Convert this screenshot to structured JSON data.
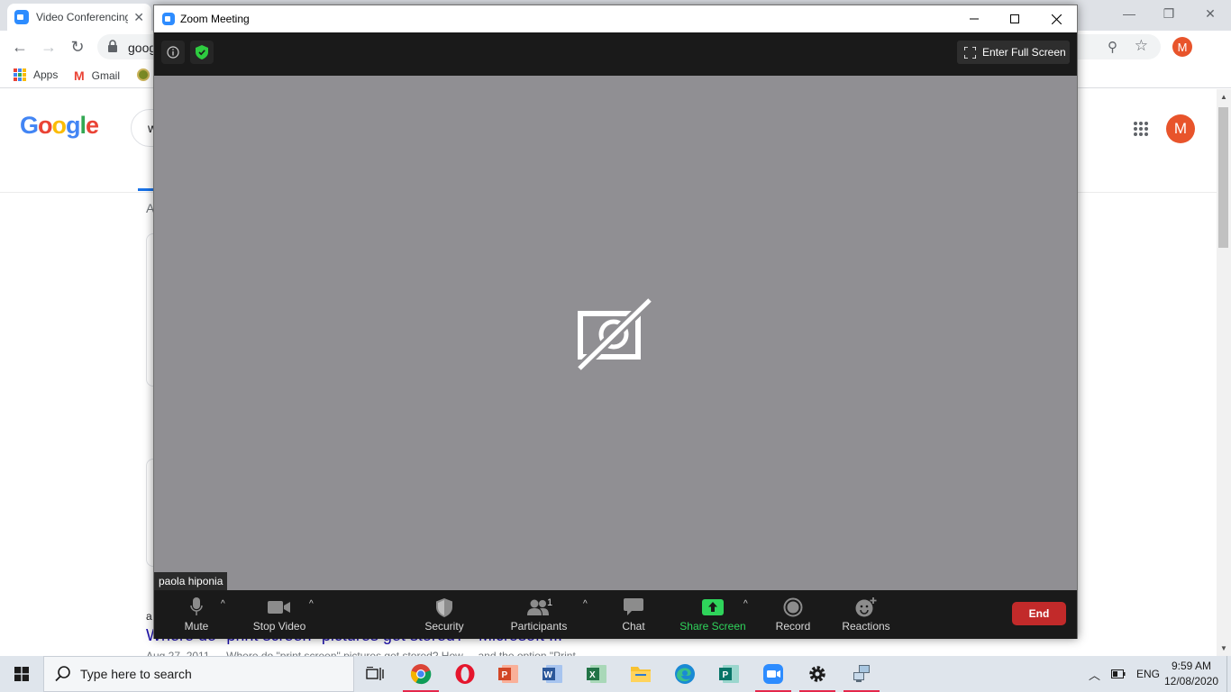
{
  "chrome": {
    "tab_title": "Video Conferencing",
    "url_text": "goog",
    "bookmarks": {
      "apps": "Apps",
      "gmail": "Gmail"
    },
    "profile_initial": "M"
  },
  "google": {
    "logo": [
      "G",
      "o",
      "o",
      "g",
      "l",
      "e"
    ],
    "search_value": "w",
    "tab_fragment": "A",
    "result_prefix": "a",
    "result_title": "Where do \"print screen\" pictures get stored? - Microsoft ...",
    "result_snippet": "Aug 27, 2011 — Where do \"print screen\" pictures get stored? How ... and the option \"Print ..."
  },
  "zoom": {
    "window_title": "Zoom Meeting",
    "fullscreen_label": "Enter Full Screen",
    "participant_name": "paola hiponia",
    "participant_count": "1",
    "toolbar": {
      "mute": "Mute",
      "stop_video": "Stop Video",
      "security": "Security",
      "participants": "Participants",
      "chat": "Chat",
      "share_screen": "Share Screen",
      "record": "Record",
      "reactions": "Reactions",
      "end": "End"
    },
    "colors": {
      "video_bg": "#908f93",
      "share_green": "#2fd45b",
      "end_red": "#c22a2a",
      "secure_green": "#2ecc40"
    }
  },
  "taskbar": {
    "search_placeholder": "Type here to search",
    "language": "ENG",
    "time": "9:59 AM",
    "date": "12/08/2020",
    "apps": [
      "task-view",
      "chrome",
      "opera",
      "powerpoint",
      "word",
      "excel",
      "file-explorer",
      "edge",
      "publisher",
      "zoom",
      "settings",
      "network-app"
    ]
  }
}
